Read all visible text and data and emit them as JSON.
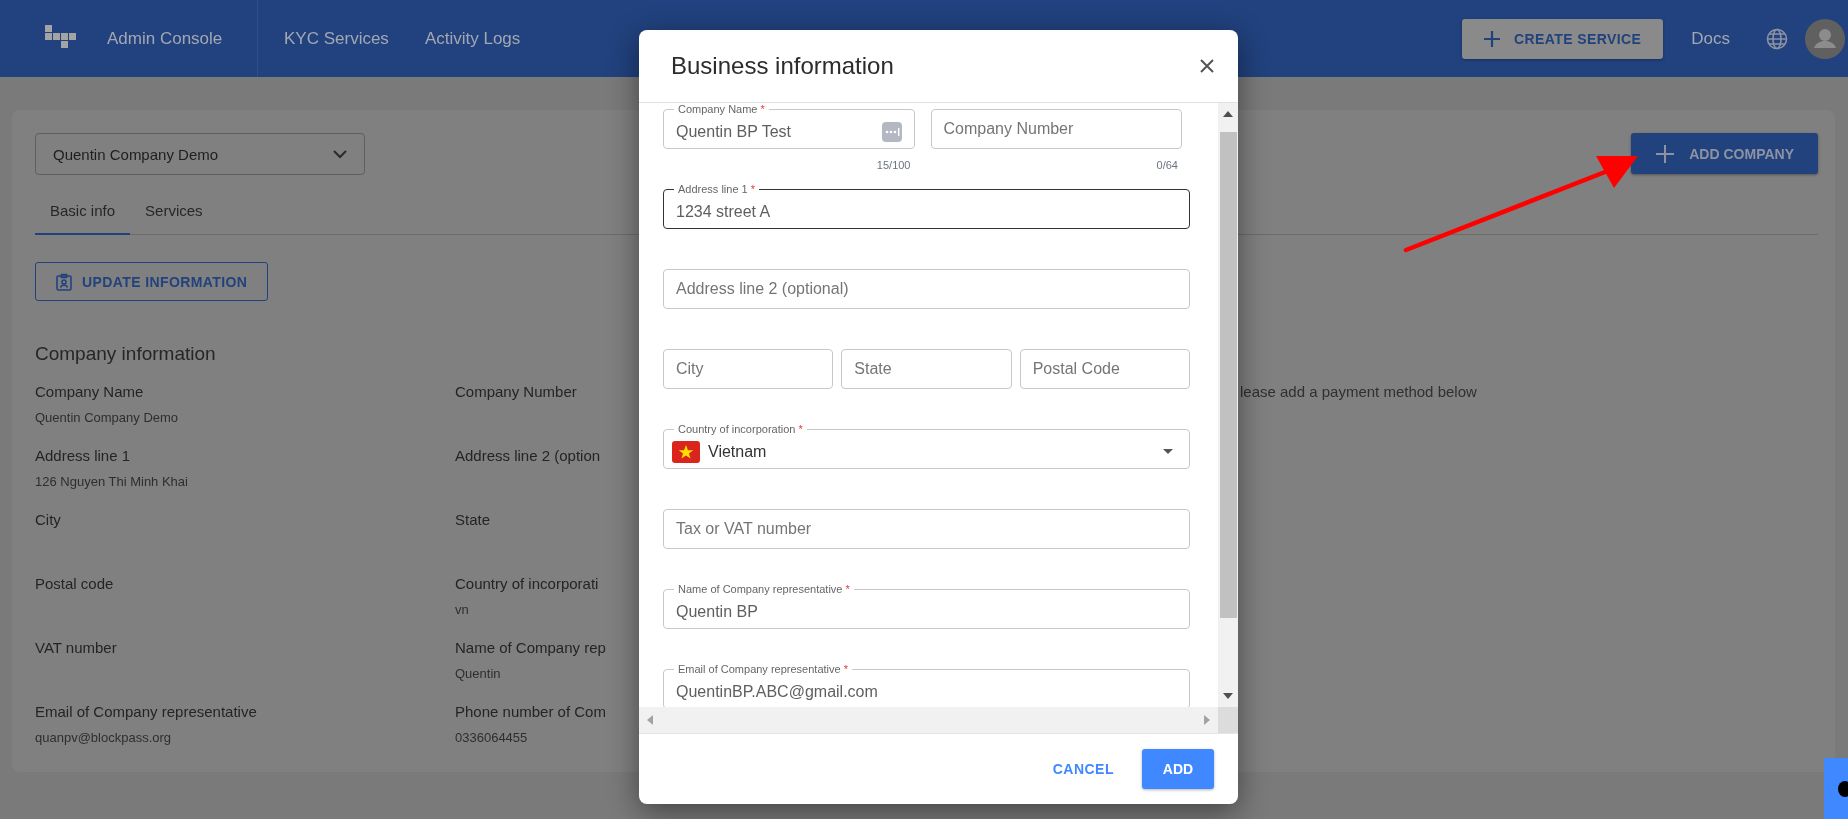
{
  "header": {
    "brand": "Admin Console",
    "nav": [
      {
        "label": "KYC Services"
      },
      {
        "label": "Activity Logs"
      }
    ],
    "create_button": "CREATE SERVICE",
    "docs": "Docs"
  },
  "company_select": {
    "value": "Quentin Company Demo"
  },
  "add_company_button": "ADD COMPANY",
  "tabs": [
    {
      "label": "Basic info",
      "selected": true
    },
    {
      "label": "Services",
      "selected": false
    }
  ],
  "update_button": "UPDATE INFORMATION",
  "section_title": "Company information",
  "info_rows": [
    {
      "cells": [
        {
          "kind": "field",
          "label": "Company Name",
          "value": "Quentin Company Demo"
        },
        {
          "kind": "field",
          "label": "Company Number"
        },
        {
          "kind": "notice",
          "text": "lease add a payment method below"
        }
      ]
    },
    {
      "cells": [
        {
          "kind": "field",
          "label": "Address line 1",
          "value": "126 Nguyen Thi Minh Khai"
        },
        {
          "kind": "field",
          "label": "Address line 2 (option"
        }
      ]
    },
    {
      "cells": [
        {
          "kind": "field",
          "label": "City"
        },
        {
          "kind": "field",
          "label": "State"
        }
      ]
    },
    {
      "cells": [
        {
          "kind": "field",
          "label": "Postal code"
        },
        {
          "kind": "field",
          "label": "Country of incorporati",
          "value": "vn"
        }
      ]
    },
    {
      "cells": [
        {
          "kind": "field",
          "label": "VAT number"
        },
        {
          "kind": "field",
          "label": "Name of Company rep",
          "value": "Quentin"
        }
      ]
    },
    {
      "cells": [
        {
          "kind": "field",
          "label": "Email of Company representative",
          "value": "quanpv@blockpass.org"
        },
        {
          "kind": "field",
          "label": "Phone number of Com",
          "value": "0336064455"
        }
      ]
    }
  ],
  "dialog": {
    "title": "Business information",
    "rows": [
      {
        "fields": [
          {
            "kind": "text",
            "label": "Company Name",
            "required_mark": "*",
            "value": "Quentin BP Test",
            "counter": "15/100",
            "autofill_icon": true,
            "focused": false
          },
          {
            "kind": "text",
            "placeholder": "Company Number",
            "counter": "0/64",
            "focused": false
          }
        ]
      },
      {
        "fields": [
          {
            "kind": "text",
            "label": "Address line 1",
            "required_mark": "*",
            "value": "1234 street A",
            "focused": true
          }
        ]
      },
      {
        "fields": [
          {
            "kind": "text",
            "placeholder": "Address line 2 (optional)",
            "focused": false
          }
        ]
      },
      {
        "fields": [
          {
            "kind": "text",
            "placeholder": "City",
            "focused": false
          },
          {
            "kind": "text",
            "placeholder": "State",
            "focused": false
          },
          {
            "kind": "text",
            "placeholder": "Postal Code",
            "focused": false
          }
        ]
      },
      {
        "fields": [
          {
            "kind": "select",
            "label": "Country of incorporation",
            "required_mark": "*",
            "value": "Vietnam",
            "focused": false
          }
        ]
      },
      {
        "fields": [
          {
            "kind": "text",
            "placeholder": "Tax or VAT number",
            "focused": false
          }
        ]
      },
      {
        "fields": [
          {
            "kind": "text",
            "label": "Name of Company representative",
            "required_mark": "*",
            "value": "Quentin BP",
            "focused": false
          }
        ]
      },
      {
        "fields": [
          {
            "kind": "text",
            "label": "Email of Company representative",
            "required_mark": "*",
            "value": "QuentinBP.ABC@gmail.com",
            "focused": false
          }
        ]
      }
    ],
    "cancel": "CANCEL",
    "add": "ADD"
  }
}
